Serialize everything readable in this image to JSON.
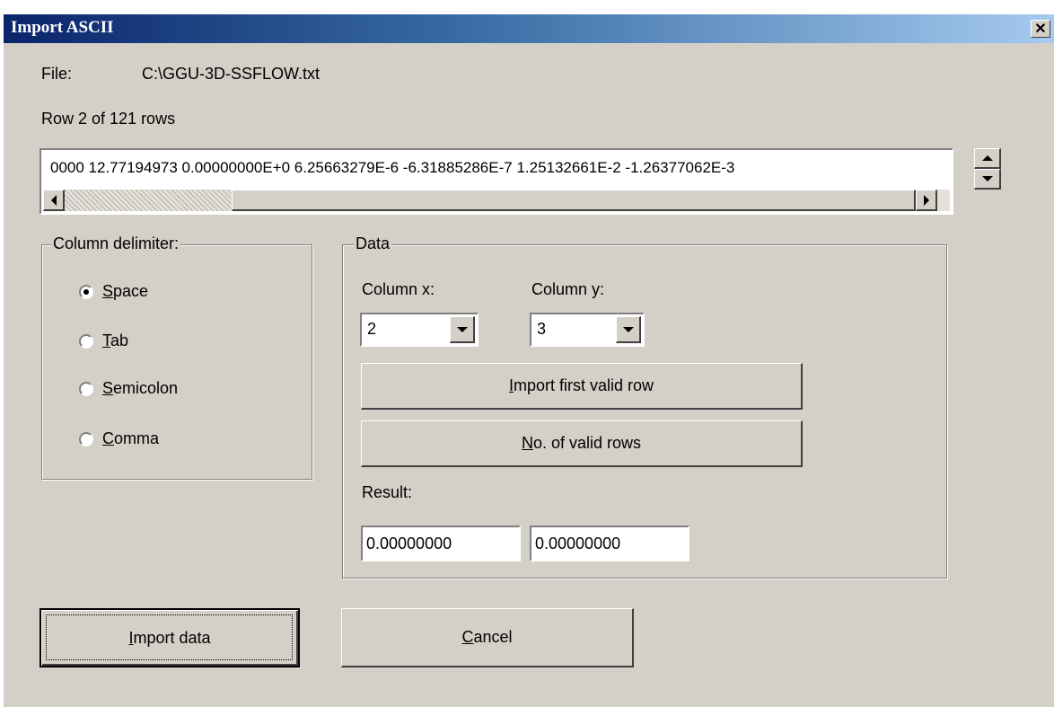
{
  "window": {
    "title": "Import ASCII",
    "close_glyph": "✕"
  },
  "file": {
    "label": "File:",
    "path": "C:\\GGU-3D-SSFLOW.txt"
  },
  "row_status": "Row 2 of  121 rows",
  "preview": {
    "line": "0000 12.77194973  0.00000000E+0  6.25663279E-6 -6.31885286E-7  1.25132661E-2 -1.26377062E-3"
  },
  "delimiter": {
    "title": "Column delimiter:",
    "options": [
      {
        "label": "Space",
        "selected": true
      },
      {
        "label": "Tab",
        "selected": false
      },
      {
        "label": "Semicolon",
        "selected": false
      },
      {
        "label": "Comma",
        "selected": false
      }
    ]
  },
  "data_group": {
    "title": "Data",
    "column_x_label": "Column x:",
    "column_y_label": "Column y:",
    "column_x_value": "2",
    "column_y_value": "3",
    "import_first_label": "Import first valid row",
    "valid_rows_label": "No. of valid rows",
    "result_label": "Result:",
    "result_x": "0.00000000",
    "result_y": "0.00000000"
  },
  "buttons": {
    "import_label": "Import data",
    "cancel_label": "Cancel"
  }
}
